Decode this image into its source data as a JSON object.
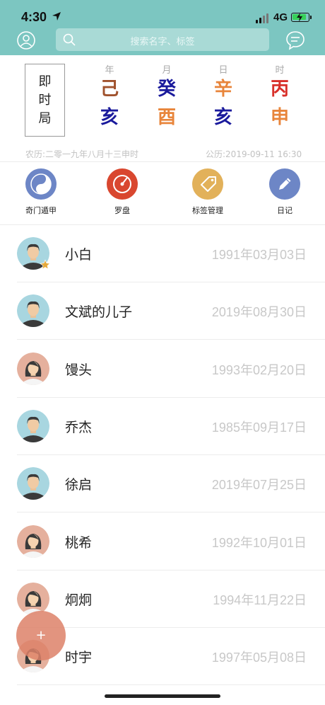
{
  "status": {
    "time": "4:30",
    "network": "4G"
  },
  "search": {
    "placeholder": "搜索名字、标签"
  },
  "ju_label": [
    "即",
    "时",
    "局"
  ],
  "pillars": [
    {
      "label": "年",
      "top": "己",
      "bottom": "亥",
      "top_color": "#a0522d",
      "bottom_color": "#1a1a9c"
    },
    {
      "label": "月",
      "top": "癸",
      "bottom": "酉",
      "top_color": "#1a1a9c",
      "bottom_color": "#e8853b"
    },
    {
      "label": "日",
      "top": "辛",
      "bottom": "亥",
      "top_color": "#e8853b",
      "bottom_color": "#1a1a9c"
    },
    {
      "label": "时",
      "top": "丙",
      "bottom": "申",
      "top_color": "#d8302a",
      "bottom_color": "#e8853b"
    }
  ],
  "lunar_date": "农历:二零一九年八月十三申时",
  "solar_date": "公历:2019-09-11 16:30",
  "tools": [
    {
      "label": "奇门遁甲",
      "icon": "yin-yang-icon",
      "color": "#6d86c6"
    },
    {
      "label": "罗盘",
      "icon": "compass-icon",
      "color": "#d9472f"
    },
    {
      "label": "标签管理",
      "icon": "tag-icon",
      "color": "#e2b15a"
    },
    {
      "label": "日记",
      "icon": "pencil-icon",
      "color": "#6d86c6"
    }
  ],
  "contacts": [
    {
      "name": "小白",
      "date": "1991年03月03日",
      "gender": "male",
      "starred": true
    },
    {
      "name": "文斌的儿子",
      "date": "2019年08月30日",
      "gender": "male",
      "starred": false
    },
    {
      "name": "馒头",
      "date": "1993年02月20日",
      "gender": "female",
      "starred": false
    },
    {
      "name": "乔杰",
      "date": "1985年09月17日",
      "gender": "male",
      "starred": false
    },
    {
      "name": "徐启",
      "date": "2019年07月25日",
      "gender": "male",
      "starred": false
    },
    {
      "name": "桃希",
      "date": "1992年10月01日",
      "gender": "female",
      "starred": false
    },
    {
      "name": "炯炯",
      "date": "1994年11月22日",
      "gender": "female",
      "starred": false
    },
    {
      "name": "时宇",
      "date": "1997年05月08日",
      "gender": "female",
      "starred": false
    }
  ],
  "fab_label": "+"
}
